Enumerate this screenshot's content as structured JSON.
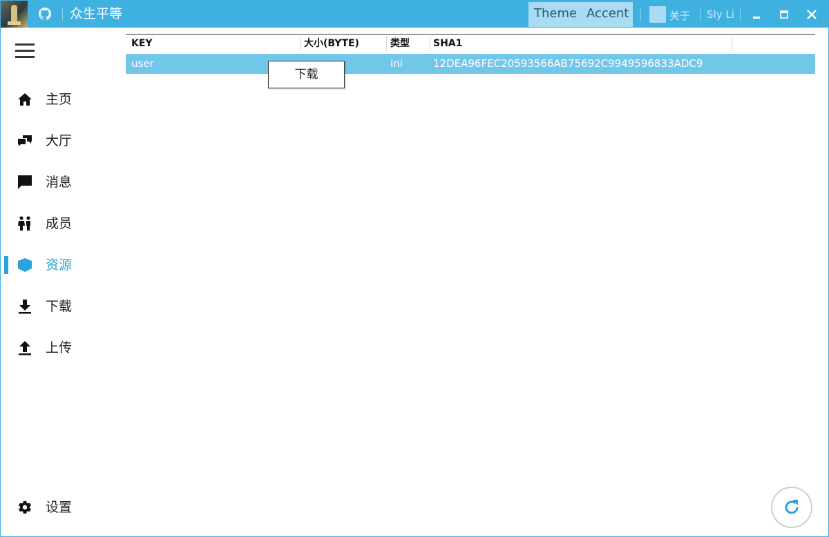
{
  "titlebar": {
    "title": "众生平等",
    "theme_label": "Theme",
    "accent_label": "Accent",
    "about_label": "关于",
    "user_label": "Sly Li"
  },
  "sidebar": {
    "items": [
      {
        "label": "主页",
        "icon": "home-icon"
      },
      {
        "label": "大厅",
        "icon": "chat-bubbles-icon"
      },
      {
        "label": "消息",
        "icon": "message-icon"
      },
      {
        "label": "成员",
        "icon": "people-icon"
      },
      {
        "label": "资源",
        "icon": "cube-icon",
        "active": true
      },
      {
        "label": "下载",
        "icon": "download-icon"
      },
      {
        "label": "上传",
        "icon": "upload-icon"
      }
    ],
    "settings_label": "设置"
  },
  "table": {
    "columns": [
      "KEY",
      "大小(BYTE)",
      "类型",
      "SHA1"
    ],
    "rows": [
      {
        "key": "user",
        "size": "",
        "type": "ini",
        "sha1": "12DEA96FEC20593566AB75692C9949596833ADC9"
      }
    ]
  },
  "context_menu": {
    "items": [
      "下载"
    ]
  },
  "colors": {
    "accent": "#3fb1e1",
    "selected_row": "#72c6ea",
    "active_nav": "#2ba4dc"
  }
}
